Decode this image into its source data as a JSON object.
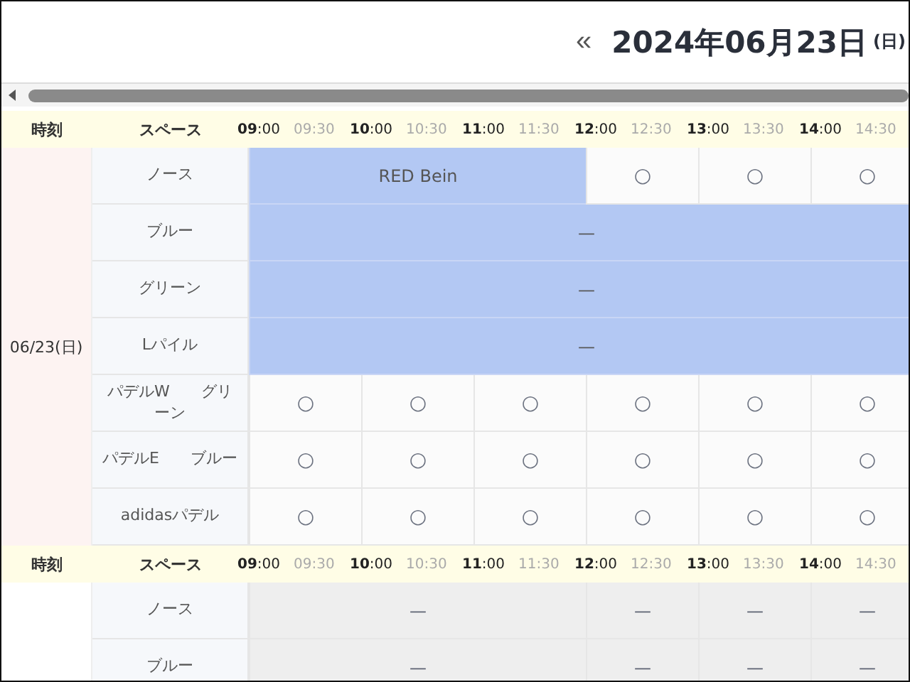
{
  "header": {
    "prev_button": "«",
    "date": "2024年06月23日",
    "weekday": "(日)"
  },
  "sections": [
    {
      "date": "06/23(日)",
      "header": {
        "time_label": "時刻",
        "space_label": "スペース",
        "times": [
          {
            "label": "**09**:00",
            "kind": "hour"
          },
          {
            "label": "09:30",
            "kind": "half"
          },
          {
            "label": "**10**:00",
            "kind": "hour"
          },
          {
            "label": "10:30",
            "kind": "half"
          },
          {
            "label": "**11**:00",
            "kind": "hour"
          },
          {
            "label": "11:30",
            "kind": "half"
          },
          {
            "label": "**12**:00",
            "kind": "hour"
          },
          {
            "label": "12:30",
            "kind": "half"
          },
          {
            "label": "**13**:00",
            "kind": "hour"
          },
          {
            "label": "13:30",
            "kind": "half"
          },
          {
            "label": "**14**:00",
            "kind": "hour"
          },
          {
            "label": "14:30",
            "kind": "half"
          }
        ]
      },
      "rows": [
        {
          "space": "ノース",
          "cells": [
            {
              "kind": "booked"
            },
            {
              "kind": "booked",
              "label": "RED Bein"
            },
            {
              "kind": "booked"
            },
            {
              "kind": "open",
              "label": "○"
            },
            {
              "kind": "open",
              "label": "○"
            },
            {
              "kind": "open",
              "label": "○"
            }
          ]
        },
        {
          "space": "ブルー",
          "cells": [
            {
              "kind": "booked"
            },
            {
              "kind": "booked"
            },
            {
              "kind": "booked"
            },
            {
              "kind": "booked",
              "label": "—"
            },
            {
              "kind": "booked"
            },
            {
              "kind": "booked"
            }
          ]
        },
        {
          "space": "グリーン",
          "cells": [
            {
              "kind": "booked"
            },
            {
              "kind": "booked"
            },
            {
              "kind": "booked"
            },
            {
              "kind": "booked",
              "label": "—"
            },
            {
              "kind": "booked"
            },
            {
              "kind": "booked"
            }
          ]
        },
        {
          "space": "Lパイル",
          "cells": [
            {
              "kind": "booked"
            },
            {
              "kind": "booked"
            },
            {
              "kind": "booked"
            },
            {
              "kind": "booked",
              "label": "—"
            },
            {
              "kind": "booked"
            },
            {
              "kind": "booked"
            }
          ]
        },
        {
          "space": "パデルW　　グリーン",
          "cells": [
            {
              "kind": "open",
              "label": "○"
            },
            {
              "kind": "open",
              "label": "○"
            },
            {
              "kind": "open",
              "label": "○"
            },
            {
              "kind": "open",
              "label": "○"
            },
            {
              "kind": "open",
              "label": "○"
            },
            {
              "kind": "open",
              "label": "○"
            }
          ]
        },
        {
          "space": "パデルE　　ブルー",
          "cells": [
            {
              "kind": "open",
              "label": "○"
            },
            {
              "kind": "open",
              "label": "○"
            },
            {
              "kind": "open",
              "label": "○"
            },
            {
              "kind": "open",
              "label": "○"
            },
            {
              "kind": "open",
              "label": "○"
            },
            {
              "kind": "open",
              "label": "○"
            }
          ]
        },
        {
          "space": "adidasパデル",
          "cells": [
            {
              "kind": "open",
              "label": "○"
            },
            {
              "kind": "open",
              "label": "○"
            },
            {
              "kind": "open",
              "label": "○"
            },
            {
              "kind": "open",
              "label": "○"
            },
            {
              "kind": "open",
              "label": "○"
            },
            {
              "kind": "open",
              "label": "○"
            }
          ]
        }
      ]
    },
    {
      "header": {
        "time_label": "時刻",
        "space_label": "スペース",
        "times": [
          {
            "label": "**09**:00",
            "kind": "hour"
          },
          {
            "label": "09:30",
            "kind": "half"
          },
          {
            "label": "**10**:00",
            "kind": "hour"
          },
          {
            "label": "10:30",
            "kind": "half"
          },
          {
            "label": "**11**:00",
            "kind": "hour"
          },
          {
            "label": "11:30",
            "kind": "half"
          },
          {
            "label": "**12**:00",
            "kind": "hour"
          },
          {
            "label": "12:30",
            "kind": "half"
          },
          {
            "label": "**13**:00",
            "kind": "hour"
          },
          {
            "label": "13:30",
            "kind": "half"
          },
          {
            "label": "**14**:00",
            "kind": "hour"
          },
          {
            "label": "14:30",
            "kind": "half"
          }
        ]
      },
      "rows": [
        {
          "space": "ノース",
          "cells": [
            {
              "kind": "closed"
            },
            {
              "kind": "closed",
              "label": "—"
            },
            {
              "kind": "closed"
            },
            {
              "kind": "closed",
              "label": "—"
            },
            {
              "kind": "closed",
              "label": "—"
            },
            {
              "kind": "closed",
              "label": "—"
            }
          ]
        },
        {
          "space": "ブルー",
          "cells": [
            {
              "kind": "closed"
            },
            {
              "kind": "closed",
              "label": "—"
            },
            {
              "kind": "closed"
            },
            {
              "kind": "closed",
              "label": "—"
            },
            {
              "kind": "closed",
              "label": "—"
            },
            {
              "kind": "closed",
              "label": "—"
            }
          ]
        }
      ]
    }
  ]
}
